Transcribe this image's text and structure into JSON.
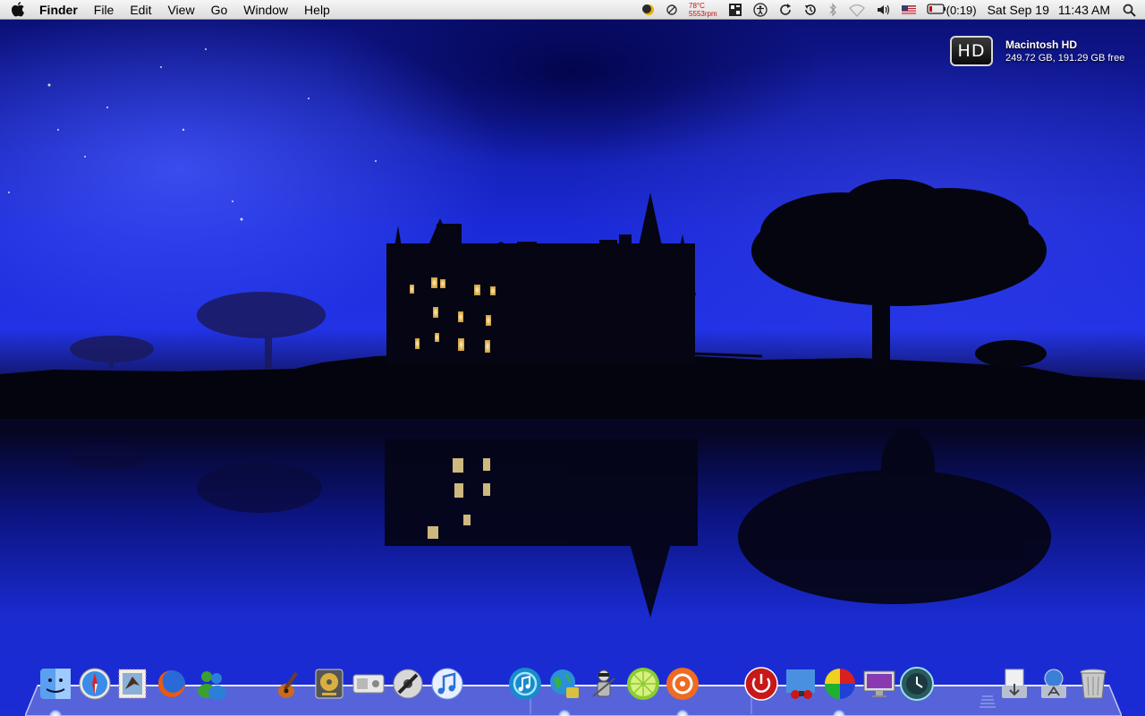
{
  "menubar": {
    "app_name": "Finder",
    "menus": [
      "File",
      "Edit",
      "View",
      "Go",
      "Window",
      "Help"
    ],
    "temperature": "78°C",
    "fan_speed": "5553rpm",
    "battery_time": "(0:19)",
    "date": "Sat Sep 19",
    "time": "11:43 AM",
    "icons": [
      "apple-logo",
      "moon-icon",
      "no-entry-icon",
      "memory-icon",
      "accessibility-icon",
      "sync-icon",
      "time-machine-icon",
      "bluetooth-icon",
      "wifi-icon",
      "volume-icon",
      "us-flag-icon",
      "battery-icon",
      "spotlight-icon"
    ]
  },
  "hd_widget": {
    "icon_label": "HD",
    "name": "Macintosh HD",
    "space": "249.72 GB, 191.29 GB free"
  },
  "dock": {
    "items": [
      "finder",
      "safari",
      "mail",
      "firefox",
      "messenger",
      "garageband",
      "disk-utility",
      "tv",
      "dvd-player",
      "itunes",
      "itunes-blue",
      "network-utility",
      "automator",
      "lime",
      "burn",
      "shutdown",
      "photo-booth",
      "color-picker",
      "screen",
      "time-machine",
      "downloads",
      "applications",
      "trash"
    ],
    "running": [
      "finder",
      "itunes-blue",
      "burn",
      "shutdown"
    ]
  },
  "colors": {
    "sky_top": "#0a0e6e",
    "sky_mid": "#2233e6",
    "menubar": "#e8e8e8"
  }
}
